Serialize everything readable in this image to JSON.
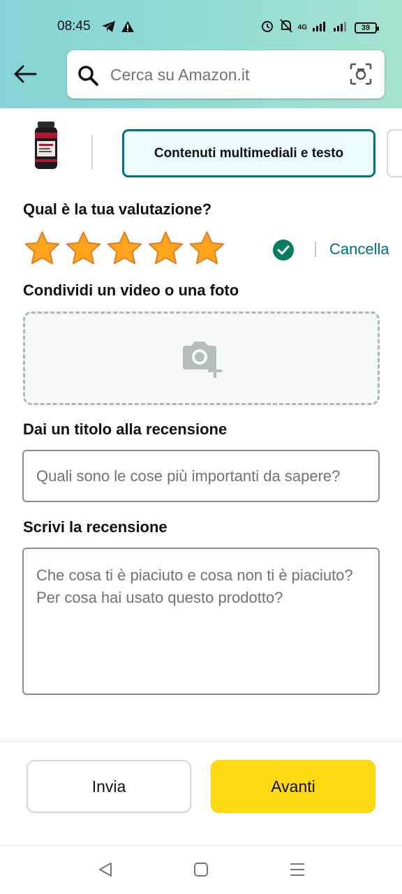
{
  "status_bar": {
    "time": "08:45",
    "network": "4G",
    "battery": "39"
  },
  "header": {
    "search_placeholder": "Cerca su Amazon.it"
  },
  "tabs": {
    "active_label": "Contenuti multimediali e testo"
  },
  "rating": {
    "question": "Qual è la tua valutazione?",
    "stars_selected": 5,
    "stars_total": 5,
    "cancel_label": "Cancella",
    "star_color": "#ffa41c"
  },
  "media": {
    "label": "Condividi un video o una foto"
  },
  "review_title": {
    "label": "Dai un titolo alla recensione",
    "placeholder": "Quali sono le cose più importanti da sapere?"
  },
  "review_body": {
    "label": "Scrivi la recensione",
    "placeholder": "Che cosa ti è piaciuto e cosa non ti è piaciuto?Per cosa hai usato questo prodotto?"
  },
  "actions": {
    "submit_label": "Invia",
    "next_label": "Avanti",
    "next_color": "#ffd814"
  },
  "icons": {
    "back": "arrow-left-icon",
    "search": "search-icon",
    "camera_search": "camera-search-icon",
    "add_photo": "add-photo-icon",
    "check": "check-circle-icon"
  }
}
